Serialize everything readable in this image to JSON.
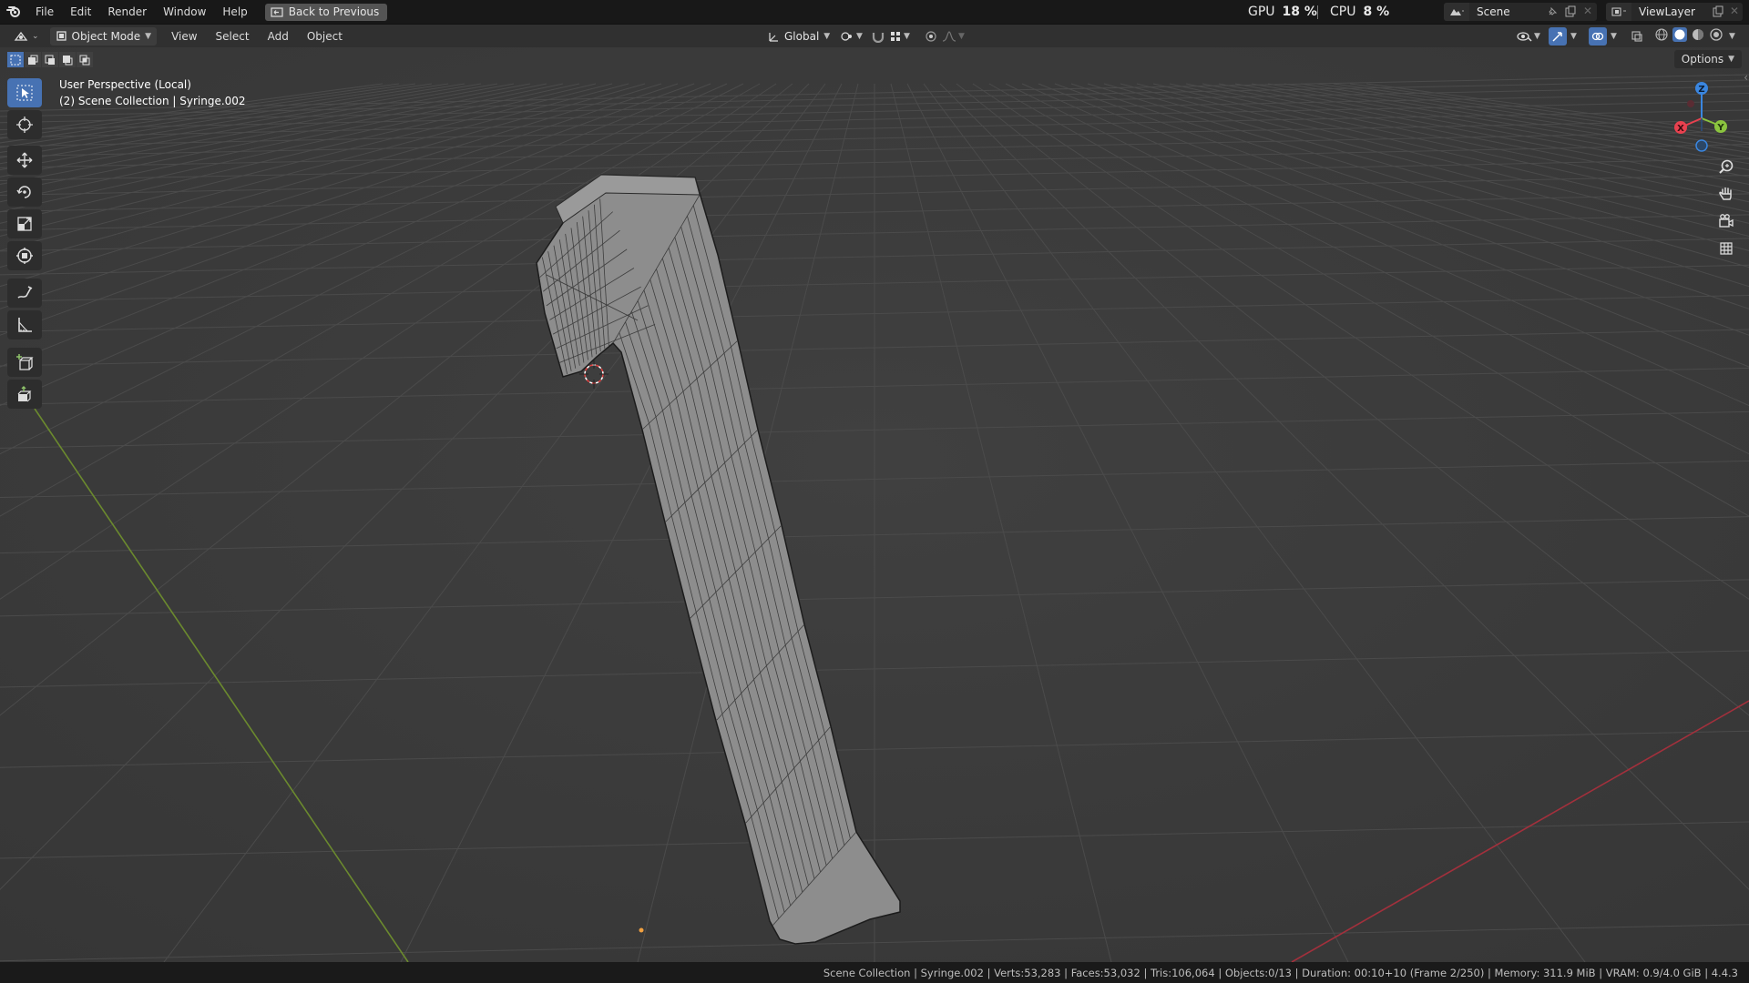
{
  "menubar": {
    "items": [
      "File",
      "Edit",
      "Render",
      "Window",
      "Help"
    ],
    "back_button": "Back to Previous",
    "gpu_label": "GPU",
    "gpu_value": "18 %",
    "cpu_label": "CPU",
    "cpu_value": "8 %",
    "scene_name": "Scene",
    "view_layer": "ViewLayer"
  },
  "header": {
    "mode": "Object Mode",
    "menus": [
      "View",
      "Select",
      "Add",
      "Object"
    ],
    "orientation": "Global"
  },
  "viewport": {
    "perspective": "User Perspective (Local)",
    "collection_info": "(2) Scene Collection | Syringe.002",
    "options_label": "Options",
    "gizmo": {
      "x": "X",
      "y": "Y",
      "z": "Z"
    }
  },
  "tools": [
    "select-box",
    "cursor",
    "move",
    "rotate",
    "scale",
    "transform",
    "annotate",
    "measure",
    "add-cube",
    "extrude"
  ],
  "statusbar": {
    "text": "Scene Collection | Syringe.002 | Verts:53,283 | Faces:53,032 | Tris:106,064 | Objects:0/13 | Duration: 00:10+10 (Frame 2/250) | Memory: 311.9 MiB | VRAM: 0.9/4.0 GiB | 4.4.3"
  },
  "colors": {
    "accent": "#4772b3",
    "x_axis": "#e8414f",
    "y_axis": "#8bc43f",
    "z_axis": "#3a86e0",
    "grid_green": "#6b8a2e",
    "grid_red": "#a3303c"
  }
}
